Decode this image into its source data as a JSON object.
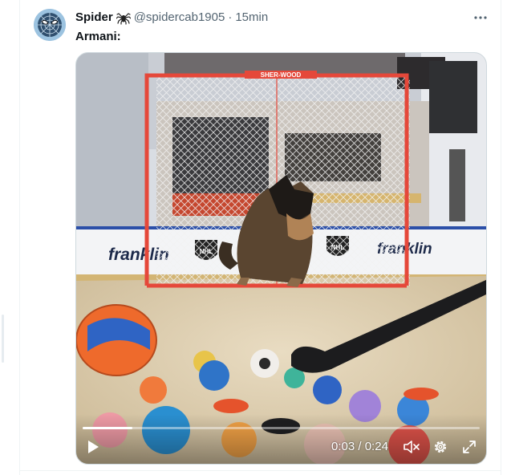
{
  "tweet": {
    "display_name": "Spider",
    "name_emoji": "spider-emoji",
    "handle": "@spidercab1905",
    "separator": "·",
    "timestamp": "15min",
    "text": "Armani:",
    "avatar_icon": "spider-man-mask-avatar"
  },
  "video": {
    "current_time": "0:03",
    "duration": "0:24",
    "time_divider": " / ",
    "progress_fraction": 0.125,
    "paused": true,
    "muted": true,
    "scene_logos": {
      "left_board": "franklin",
      "right_board": "franklin",
      "goal_crossbar": "SHER-WOOD"
    }
  },
  "colors": {
    "text_primary": "#0f1419",
    "text_secondary": "#536471",
    "border": "#cfd9de"
  }
}
